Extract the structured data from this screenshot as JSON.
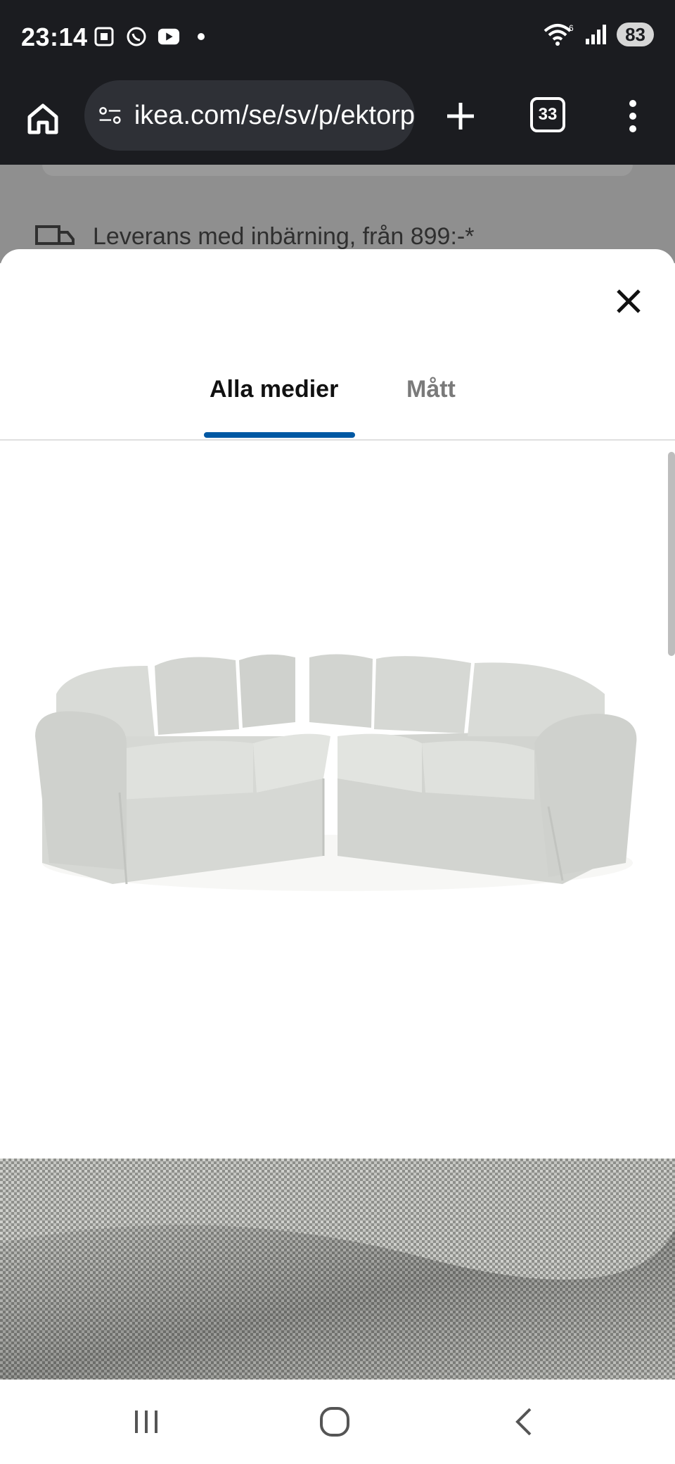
{
  "status": {
    "time": "23:14",
    "battery": "83",
    "signal_tag": "6",
    "icons": [
      "screenshot-icon",
      "whatsapp-icon",
      "youtube-icon",
      "dot-icon",
      "wifi-icon",
      "signal-icon"
    ]
  },
  "browser": {
    "url": "ikea.com/se/sv/p/ektorp",
    "tab_count": "33"
  },
  "background_page": {
    "delivery_text": "Leverans med inbärning, från 899:-*"
  },
  "modal": {
    "tabs": [
      {
        "label": "Alla medier",
        "active": true
      },
      {
        "label": "Mått",
        "active": false
      }
    ],
    "accent_color": "#0058a3"
  },
  "media": {
    "images": [
      "corner-sofa-image",
      "fabric-closeup-image"
    ]
  }
}
